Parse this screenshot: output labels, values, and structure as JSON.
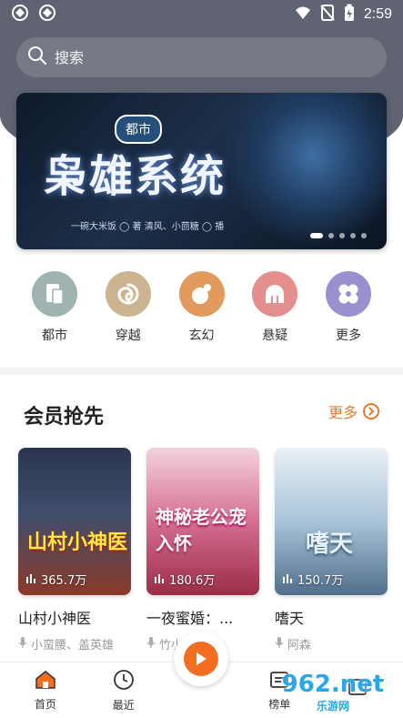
{
  "status": {
    "time": "2:59"
  },
  "search": {
    "placeholder": "搜索",
    "icon": "search-icon"
  },
  "banner": {
    "tag": "都市",
    "title": "枭雄系统",
    "credits": "一碗大米饭 ◯ 著   清风、小茴糖 ◯ 播",
    "dots": 5,
    "active_dot": 0
  },
  "categories": [
    {
      "label": "都市",
      "icon": "document-icon",
      "color": "#9fb4b0"
    },
    {
      "label": "穿越",
      "icon": "swirl-icon",
      "color": "#cdb491"
    },
    {
      "label": "玄幻",
      "icon": "orb-icon",
      "color": "#e39a5e"
    },
    {
      "label": "悬疑",
      "icon": "helmet-icon",
      "color": "#e58e8e"
    },
    {
      "label": "更多",
      "icon": "clover-icon",
      "color": "#9a8fcf"
    }
  ],
  "section": {
    "title": "会员抢先",
    "more_label": "更多"
  },
  "books": [
    {
      "name": "山村小神医",
      "author": "小蛮腰、盖英雄",
      "views": "365.7万",
      "cover_title": "山村小神医"
    },
    {
      "name": "一夜蜜婚：...",
      "author": "竹小春",
      "views": "180.6万",
      "cover_title": "神秘老公宠入怀"
    },
    {
      "name": "嗜天",
      "author": "阿森",
      "views": "150.7万",
      "cover_title": "嗜天"
    }
  ],
  "bottom_nav": [
    {
      "label": "首页",
      "icon": "home-icon"
    },
    {
      "label": "最近",
      "icon": "clock-icon"
    },
    {
      "label": "",
      "icon": "play-icon"
    },
    {
      "label": "榜单",
      "icon": "rank-icon"
    },
    {
      "label": "",
      "icon": "profile-icon"
    }
  ],
  "watermark": {
    "top": "962.net",
    "bottom": "乐游网"
  },
  "colors": {
    "accent": "#f36d21",
    "more": "#e87a2a",
    "header_bg": "#5f6372"
  }
}
